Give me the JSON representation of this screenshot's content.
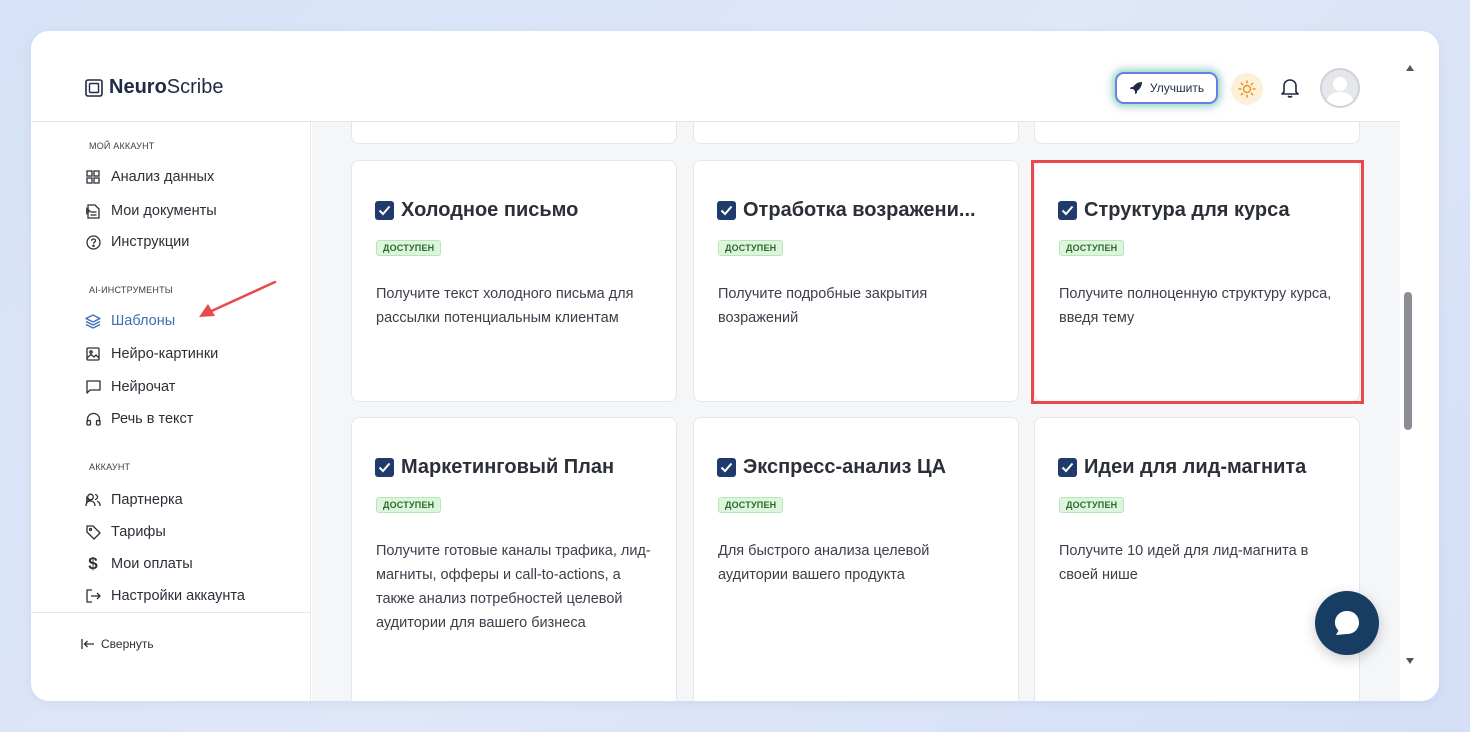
{
  "app": {
    "logo_bold": "Neuro",
    "logo_regular": "Scribe"
  },
  "header": {
    "upgrade_label": "Улучшить"
  },
  "sidebar": {
    "section_my_account": "МОЙ АККАУНТ",
    "section_ai_tools": "AI-ИНСТРУМЕНТЫ",
    "section_account": "АККАУНТ",
    "items": [
      {
        "label": "Анализ данных",
        "icon": "grid-icon"
      },
      {
        "label": "Мои документы",
        "icon": "document-icon"
      },
      {
        "label": "Инструкции",
        "icon": "help-circle-icon"
      },
      {
        "label": "Шаблоны",
        "icon": "layers-icon",
        "active": true
      },
      {
        "label": "Нейро-картинки",
        "icon": "image-icon"
      },
      {
        "label": "Нейрочат",
        "icon": "chat-icon"
      },
      {
        "label": "Речь в текст",
        "icon": "headphones-icon"
      },
      {
        "label": "Партнерка",
        "icon": "users-icon"
      },
      {
        "label": "Тарифы",
        "icon": "tag-icon"
      },
      {
        "label": "Мои оплаты",
        "icon": "dollar-icon"
      },
      {
        "label": "Настройки аккаунта",
        "icon": "logout-icon"
      }
    ],
    "collapse_label": "Свернуть"
  },
  "cards": [
    {
      "title": "Холодное письмо",
      "badge": "ДОСТУПЕН",
      "desc": "Получите текст холодного письма для рассылки потенциальным клиентам"
    },
    {
      "title": "Отработка возражени...",
      "badge": "ДОСТУПЕН",
      "desc": "Получите подробные закрытия возражений"
    },
    {
      "title": "Структура для курса",
      "badge": "ДОСТУПЕН",
      "desc": "Получите полноценную структуру курса, введя тему"
    },
    {
      "title": "Маркетинговый План",
      "badge": "ДОСТУПЕН",
      "desc": "Получите готовые каналы трафика, лид-магниты, офферы и call-to-actions, а также анализ потребностей целевой аудитории для вашего бизнеса"
    },
    {
      "title": "Экспресс-анализ ЦА",
      "badge": "ДОСТУПЕН",
      "desc": "Для быстрого анализа целевой аудитории вашего продукта"
    },
    {
      "title": "Идеи для лид-магнита",
      "badge": "ДОСТУПЕН",
      "desc": "Получите 10 идей для лид-магнита в своей нише"
    }
  ],
  "colors": {
    "accent": "#3f6fb3",
    "highlight": "#e84a4a",
    "badge_bg": "#ddf5dd",
    "chat_button": "#173d63"
  }
}
